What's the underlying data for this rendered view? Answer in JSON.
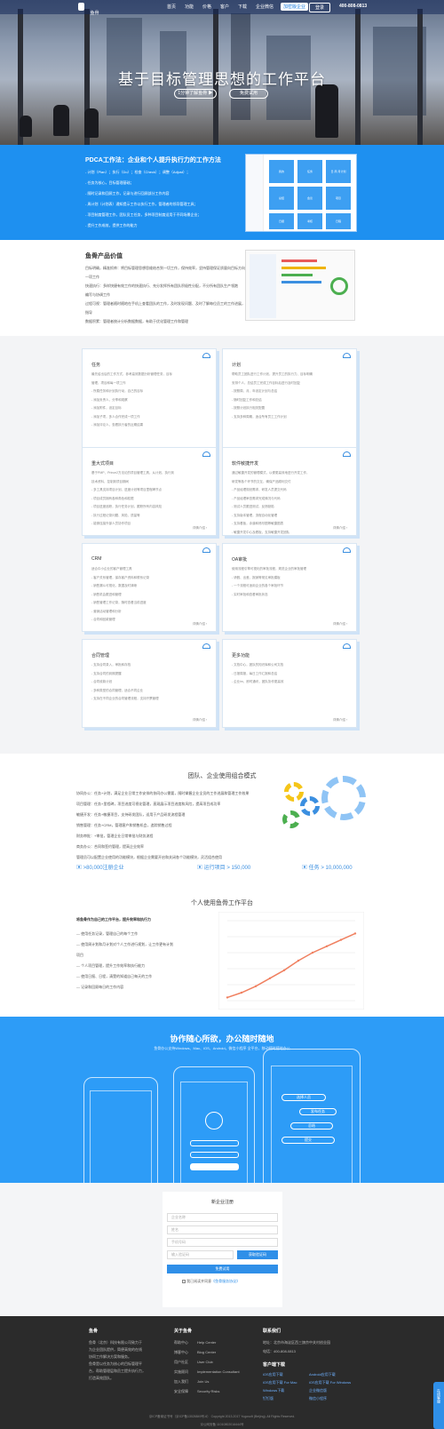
{
  "header": {
    "logo_text": "鱼骨",
    "logo_sub": "yugosoft",
    "nav": [
      "首页",
      "功能",
      "价格",
      "客户",
      "下载",
      "企业微信"
    ],
    "nav_highlight": "加密版企业",
    "login": "登录",
    "phone": "400-808-0813"
  },
  "hero": {
    "title": "基于目标管理思想的工作平台",
    "btn_video": "1分钟了解鱼骨",
    "btn_trial": "免费试用"
  },
  "pdca": {
    "title": "PDCA工作法：企业和个人提升执行力的工作方法",
    "lines": [
      "- 计划（Plan）；执行（Do）；检查（Check）；调整（Adjust）；",
      "- 任务为核心，目标管理基础；",
      "- 随时记录和回顾工作，记录与进行回顾部分工作内容",
      "- 周计划（计划表）通知提示工作以执行工作，管理者的领导管理工具；",
      "- 项目制度管理工作，团队员工任务，多种项目制度适用于不同场景企业；",
      "- 提升工作成效，提供工作的能力"
    ],
    "tiles": [
      "我的",
      "任务",
      "日·周·月计划",
      "总结",
      "会议",
      "项目",
      "日报",
      "考核",
      "日程"
    ]
  },
  "value": {
    "title": "鱼骨产品价值",
    "lines": [
      "目标明确，精准抓帅：将目标管理思想思维结合到一切工作，保持效率，坚持管理保证质量向目标方向",
      "一项工作",
      "快速执行：多样快捷有效工作的快速执行、充分发挥所有团队积极性分配，不分所有团队生产领跑",
      "编写与协调工作",
      "过程可视：管理者随时随地在手机上查看团队的工作，及时发现问题、及时了解每位员工的工作进展，跟踪当前及时",
      "指导",
      "数据积累：管理者统计分析数据数据，有助于优化管理工作和管理"
    ]
  },
  "features": [
    {
      "title": "任务",
      "lines": [
        "最先给出后的工作方式，参考高效数据分析管理任务，目标",
        "管理，项目和每一项工作",
        "- 所属任务和计划执行动，自己的目标",
        "- 添加负责人，分享和观察",
        "- 添加附件，设定目标",
        "- 添加子项，多人合作完成一项工作",
        "- 添加评论人，查看执行者的近期结果"
      ],
      "more": ""
    },
    {
      "title": "计划",
      "lines": [
        "帮助员工团队进行工作计划，提升员工的执行力、目标明确",
        "安排个人，总结员工完成工作目标后进行及时回复",
        "- 按照周、月、年设定计划与总结",
        "- 随时回复工作和总结",
        "- 按照计划执行相关配置",
        "- 支持多种周期，适合所有员工工作计划"
      ],
      "more": ""
    },
    {
      "title": "重大式项目",
      "lines": [
        "基于PMP、Prince2方法论的项目管理工具，从计划、执行到",
        "技术资料，控制到项目期间",
        "- 多工具支持项目计划、进度计划等项目里程碑节点",
        "- 项目成员拥有各种角色和权限",
        "- 项目进度追踪，执行任务计划，跟踪所有内容风险",
        "- 执行过程记录问题、风险、质量等",
        "- 能够连接外部人员协作项目"
      ],
      "more": "详情介绍 ›"
    },
    {
      "title": "软件敏捷开发",
      "lines": [
        "通过敏捷开发的管理模式，以便更高效地进行开发工作，",
        "研发等各个环节的交互，确保产品顺利交付",
        "- 产品经理规划需求，研发人员提交代码",
        "- 产品经理审查需求完成情况与代码",
        "- 测试人员跟进测试，反馈缺陷",
        "- 支持版本管理，流程自动化管理",
        "- 支持看板，泳道和燃尽图等敏捷图表",
        "- 敏捷开发中心及看板，支持敏捷开发团队"
      ],
      "more": "详情介绍 ›"
    },
    {
      "title": "CRM",
      "lines": [
        "适合中小企业的客户管理工具",
        "- 客户关系管理，保存客户资料和联系记录",
        "- 销售漏斗可视化，数据及时清晰",
        "- 销售机会跟进和管理",
        "- 销售管理工作记录，随时查看当前进度",
        "- 营销活动管理和分析",
        "- 合同和回款管理"
      ],
      "more": "详情介绍 ›"
    },
    {
      "title": "OA审批",
      "lines": [
        "使用流程引擎可视化的审批流程，规范企业的审批管理",
        "- 请假、出差、报销等常见审批模板",
        "- 一个流程可适用企业的各个审批环节",
        "- 实时审批和查看审批状态"
      ],
      "more": "详情介绍 ›"
    },
    {
      "title": "合同管理",
      "lines": [
        "- 支持合同录入，审批和存档",
        "- 支持合同的到期提醒",
        "- 合同收款计划",
        "- 多种类型的合同管理，适合不同企业",
        "- 支持在不同企业的合同管理流程，支持开票管理"
      ],
      "more": "详情介绍 ›"
    },
    {
      "title": "更多功能",
      "lines": [
        "- 文档中心，团队的知识库和公司文档",
        "- 日报周报，每日工作汇报和总结",
        "- 企业im，即时通讯，团队协作更高效"
      ],
      "more": "详情介绍 ›"
    }
  ],
  "team": {
    "title": "团队、企业使用组合模式",
    "lines": [
      "协同办公：任务+计划，满足企业日常工作安排的协同办公需要，随时掌握企业全员的工作进展和管理工作效果",
      "项目管理：任务+里程碑，项目进度可视化管理，直观展示项目进度和风险，提高项目成功率",
      "敏捷开发：任务+敏捷项目，支持研发团队，适用于产品研发流程管理",
      "销售管理：任务+CRM，管理客户和销售机会，追踪销售过程",
      "财务审批：+审批，管理企业日常审批与财务流程",
      "商务办公：合同和签约管理，提高企业效率",
      "管理员可以配置企业使用的功能模块，根据企业需要开启和关闭各个功能模块，灵活组合使用"
    ],
    "stats": [
      ">80,000注册企业",
      "运行项目 > 150,000",
      "任务 > 10,000,000"
    ]
  },
  "personal": {
    "title": "个人使用鱼骨工作平台",
    "lines": [
      "将鱼骨作为自己的工作平台，提升效率和执行力",
      "— 使用任务记录，管理自己的每个工作",
      "— 使用周计划和月计划对个人工作进行规划，让工作更有计划",
      "项目",
      "— 个人项目管理，提升工作效率和执行能力",
      "— 使用日报、日程，清楚的知道自己每天的工作",
      "— 记录和回顾每日的工作内容"
    ]
  },
  "chart_data": {
    "type": "line",
    "title": "",
    "xlabel": "",
    "ylabel": "",
    "x": [
      1,
      2,
      3,
      4,
      5,
      6,
      7,
      8,
      9,
      10
    ],
    "values": [
      2,
      5,
      9,
      14,
      19,
      25,
      30,
      34,
      38,
      42
    ],
    "ylim": [
      0,
      50
    ]
  },
  "mobile": {
    "title": "协作随心所欲，办公随时随地",
    "subtitle": "鱼骨办公支持Windows、Mac、iOS、Android，微信小程序 全平台，移动随时随地办公",
    "phone_lines": [
      "选择人员",
      "发布任务",
      "总结",
      "提交"
    ]
  },
  "register": {
    "title": "新企业注册",
    "company_ph": "企业名称",
    "name_ph": "姓名",
    "phone_ph": "手机号码",
    "code_ph": "输入验证码",
    "code_btn": "获取验证码",
    "submit": "免费试用",
    "agree": "我已阅读并同意",
    "agree_link": "《鱼骨服务协议》"
  },
  "footer": {
    "logo": "鱼骨",
    "about_lines": [
      "鱼骨（北京）科技有限公司致力于",
      "为企业团队提供，简便高效的在线",
      "协同工作解决方案和服务。",
      "鱼骨是以任务为核心的目标管理平",
      "台，帮助管理层和员工提升执行力，",
      "打造高效团队。"
    ],
    "col2_title": "关于鱼骨",
    "col2": [
      "帮助中心",
      "博客中心",
      "用户社区",
      "实施顾问",
      "加入我们",
      "安全保障"
    ],
    "col3": [
      "Help Center",
      "Blog Center",
      "User Club",
      "Implementation Consultant",
      "Join Us",
      "Security Risks"
    ],
    "contact_title": "联系我们",
    "contact": [
      "地址：北京市海淀区西三旗京中关村创业园",
      "电话：400-808-0813"
    ],
    "download_title": "客户端下载",
    "downloads": [
      "iOS应用下载",
      "Android应用下载",
      "iOS应用下载 For Mac",
      "iOS应用下载 For Windows",
      "Windows下载",
      "企业微信版",
      "钉钉版",
      "微信小程序"
    ],
    "copyright": "京ICP备案证书号（京ICP备13026849号-6） Copyright 2013-2017 Yugosoft (Beijing). All Rights Reserved.",
    "icp": "京公网安备 11010802016444号",
    "float": "在线客服"
  }
}
